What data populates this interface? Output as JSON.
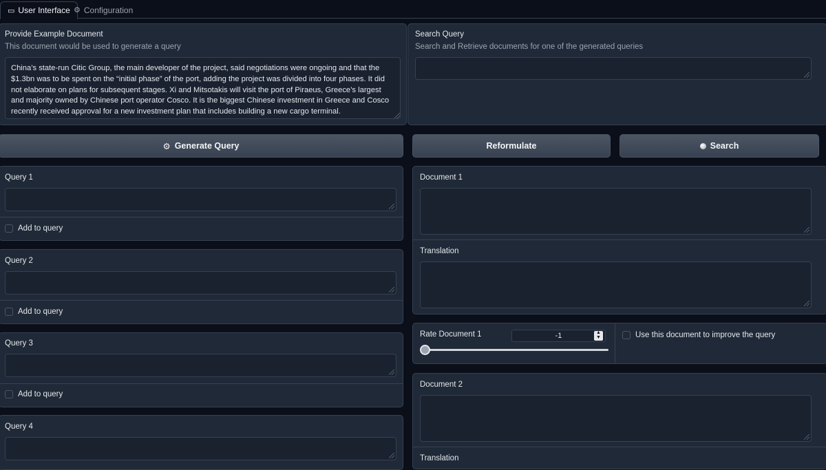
{
  "tabs": [
    {
      "label": "User Interface",
      "icon": "monitor-icon",
      "active": true
    },
    {
      "label": "Configuration",
      "icon": "gear-icon",
      "active": false
    }
  ],
  "example": {
    "label": "Provide Example Document",
    "info": "This document would be used to generate a query",
    "value": "China’s state-run Citic Group, the main developer of the project, said negotiations were ongoing and that the $1.3bn was to be spent on the “initial phase” of the port, adding the project was divided into four phases. It did not elaborate on plans for subsequent stages. Xi and Mitsotakis will visit the port of Piraeus, Greece’s largest and majority owned by Chinese port operator Cosco. It is the biggest Chinese investment in Greece and Cosco recently received approval for a new investment plan that includes building a new cargo terminal."
  },
  "search_query": {
    "label": "Search Query",
    "info": "Search and Retrieve documents for one of the generated queries",
    "value": ""
  },
  "buttons": {
    "generate": "Generate Query",
    "reformulate": "Reformulate",
    "search": "Search"
  },
  "queries": [
    {
      "label": "Query 1",
      "checkbox": "Add to query",
      "value": ""
    },
    {
      "label": "Query 2",
      "checkbox": "Add to query",
      "value": ""
    },
    {
      "label": "Query 3",
      "checkbox": "Add to query",
      "value": ""
    },
    {
      "label": "Query 4",
      "value": ""
    }
  ],
  "documents": [
    {
      "label": "Document 1",
      "translation_label": "Translation",
      "rate_label": "Rate Document 1",
      "rate_value": "-1",
      "use_label": "Use this document to improve the query"
    },
    {
      "label": "Document 2",
      "translation_label": "Translation"
    }
  ]
}
